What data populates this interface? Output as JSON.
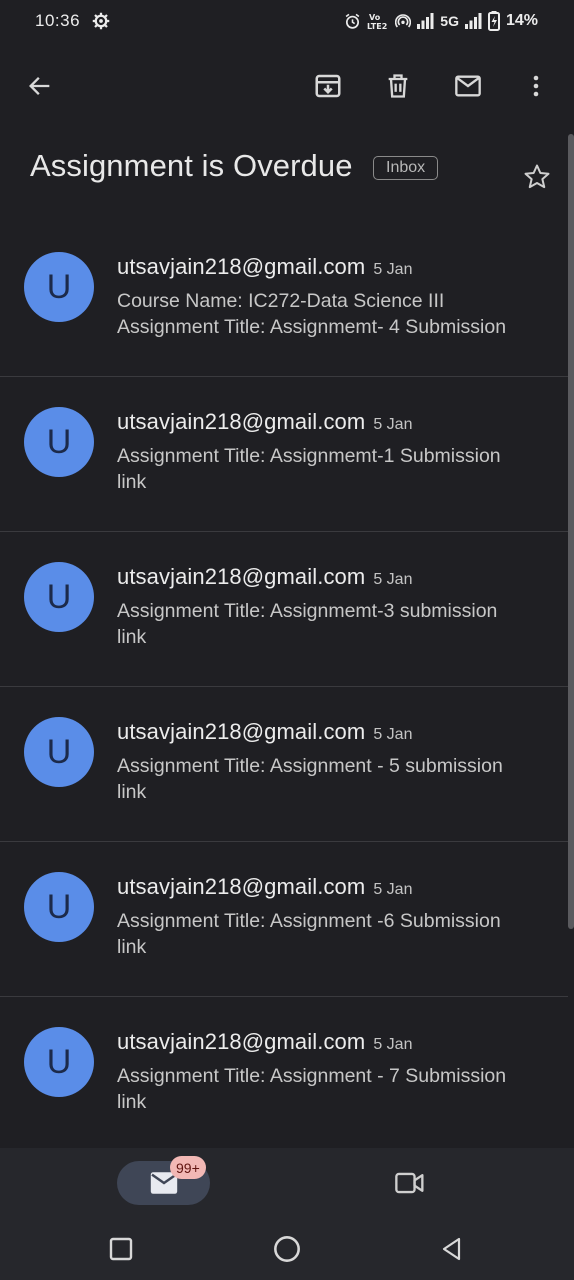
{
  "status_bar": {
    "time": "10:36",
    "network": "5G",
    "battery": "14%"
  },
  "toolbar": {
    "icons": [
      "back-arrow-icon",
      "archive-icon",
      "delete-icon",
      "mark-unread-icon",
      "more-vert-icon"
    ]
  },
  "email": {
    "subject": "Assignment is Overdue",
    "label": "Inbox"
  },
  "messages": [
    {
      "avatar": "U",
      "sender": "utsavjain218@gmail.com",
      "date": "5 Jan",
      "line1": "Course Name: IC272-Data Science III",
      "line2": "Assignment Title: Assignmemt- 4 Submission"
    },
    {
      "avatar": "U",
      "sender": "utsavjain218@gmail.com",
      "date": "5 Jan",
      "line1": "Assignment Title: Assignmemt-1 Submission",
      "line2": "link"
    },
    {
      "avatar": "U",
      "sender": "utsavjain218@gmail.com",
      "date": "5 Jan",
      "line1": "Assignment Title: Assignmemt-3 submission",
      "line2": "link"
    },
    {
      "avatar": "U",
      "sender": "utsavjain218@gmail.com",
      "date": "5 Jan",
      "line1": "Assignment Title: Assignment - 5 submission",
      "line2": "link"
    },
    {
      "avatar": "U",
      "sender": "utsavjain218@gmail.com",
      "date": "5 Jan",
      "line1": "Assignment Title: Assignment -6 Submission",
      "line2": "link"
    },
    {
      "avatar": "U",
      "sender": "utsavjain218@gmail.com",
      "date": "5 Jan",
      "line1": "Assignment Title: Assignment - 7 Submission",
      "line2": "link"
    }
  ],
  "bottom_nav": {
    "mail_badge": "99+"
  },
  "colors": {
    "background": "#1f1f23",
    "avatar": "#5a8de8",
    "badge": "#f2b8b5",
    "nav_pill": "#3f4656"
  }
}
